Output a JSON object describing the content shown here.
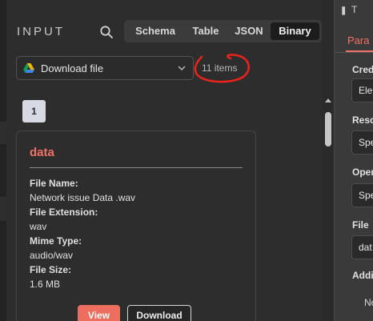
{
  "input_panel": {
    "title": "INPUT",
    "tabs": [
      {
        "label": "Schema",
        "active": false
      },
      {
        "label": "Table",
        "active": false
      },
      {
        "label": "JSON",
        "active": false
      },
      {
        "label": "Binary",
        "active": true
      }
    ],
    "source_dropdown": {
      "selected": "Download file",
      "icon": "google-drive-icon"
    },
    "items_count": "11 items",
    "page": "1",
    "binary_card": {
      "title": "data",
      "fields": [
        {
          "key": "File Name:",
          "value": "Network issue Data .wav"
        },
        {
          "key": "File Extension:",
          "value": "wav"
        },
        {
          "key": "Mime Type:",
          "value": "audio/wav"
        },
        {
          "key": "File Size:",
          "value": "1.6 MB"
        }
      ],
      "view_label": "View",
      "download_label": "Download"
    }
  },
  "parameters_panel": {
    "header_text": "T",
    "tab": "Para",
    "rows": [
      {
        "label": "Cred",
        "value": "Ele"
      },
      {
        "label": "Reso",
        "value": "Spe"
      },
      {
        "label": "Oper",
        "value": "Spe"
      },
      {
        "label": "File",
        "value": "dat"
      },
      {
        "label": "Addi",
        "value": null
      }
    ],
    "sub_option": "No"
  },
  "colors": {
    "accent": "#f07264",
    "view_button": "#ec6e5e",
    "annotation_red": "#e8231b",
    "page_button": "#d7d9e3"
  }
}
